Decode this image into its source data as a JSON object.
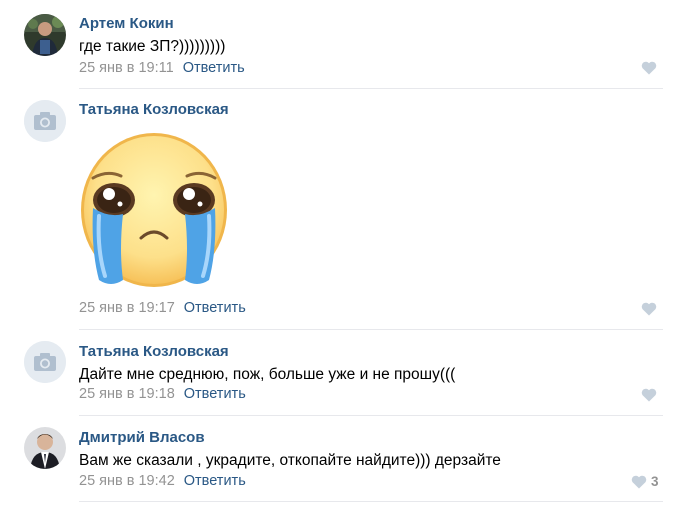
{
  "comments": [
    {
      "author": "Артем Кокин",
      "text": "где такие ЗП?)))))))))",
      "date": "25 янв в 19:11",
      "reply_label": "Ответить",
      "likes": ""
    },
    {
      "author": "Татьяна Козловская",
      "sticker": "crying-face-sticker",
      "date": "25 янв в 19:17",
      "reply_label": "Ответить",
      "likes": ""
    },
    {
      "author": "Татьяна Козловская",
      "text": "Дайте мне среднюю, пож, больше уже и не прошу(((",
      "date": "25 янв в 19:18",
      "reply_label": "Ответить",
      "likes": ""
    },
    {
      "author": "Дмитрий Власов",
      "text": "Вам же сказали , украдите, откопайте найдите))) дерзайте",
      "date": "25 янв в 19:42",
      "reply_label": "Ответить",
      "likes": "3"
    }
  ],
  "colors": {
    "link": "#2a5885",
    "muted": "#939393",
    "divider": "#e7e8ec",
    "heart": "#c5d0db"
  }
}
